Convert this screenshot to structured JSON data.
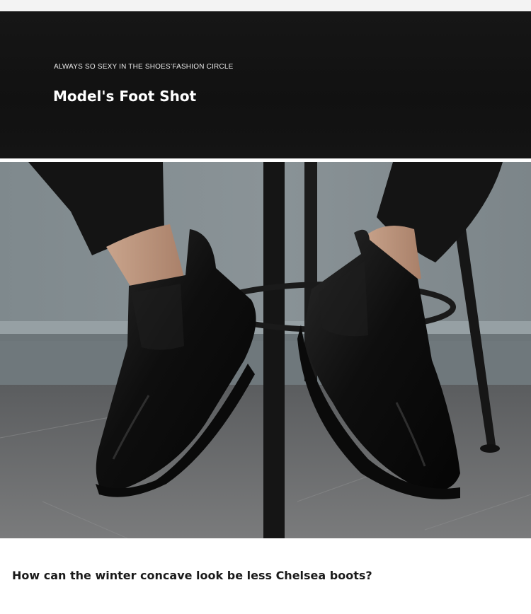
{
  "banner": {
    "tagline": "ALWAYS SO SEXY IN THE SHOES’FASHION CIRCLE",
    "title": "Model's Foot Shot"
  },
  "photo": {
    "subject": "chelsea-boots-photo"
  },
  "caption": {
    "text": "How can the winter concave look be less Chelsea boots?"
  }
}
